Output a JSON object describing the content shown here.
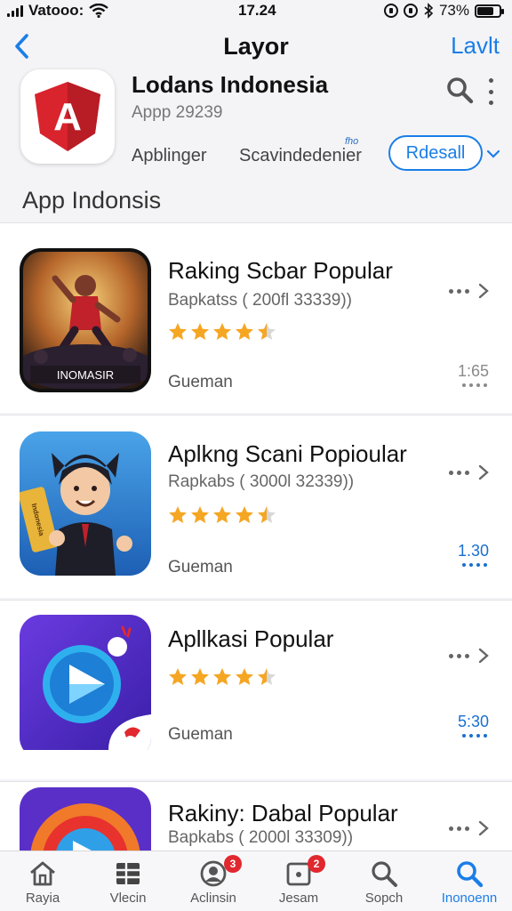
{
  "status_bar": {
    "carrier": "Vatooo:",
    "time": "17.24",
    "battery": "73%",
    "battery_level": 0.73
  },
  "nav": {
    "title": "Layor",
    "action": "Lavlt"
  },
  "app": {
    "icon_letter": "A",
    "title": "Lodans Indonesia",
    "subtitle": "Appp 29239",
    "tab1": "Apblinger",
    "tab2": "Scavindedenier",
    "tab2_sup": "fho",
    "button": "Rdesall"
  },
  "section_title": "App Indonsis",
  "apps": [
    {
      "title": "Raking Scbar Popular",
      "subtitle": "Bapkatss ( 200fl 33339))",
      "rating": 4.5,
      "category": "Gueman",
      "value": "1:65",
      "value_color": "#8a8a8a",
      "icon_label": "INOMASIR"
    },
    {
      "title": "Aplkng Scani Popioular",
      "subtitle": "Rapkabs ( 3000l 32339))",
      "rating": 4.5,
      "category": "Gueman",
      "value": "1.30",
      "value_color": "#1a6fd0",
      "icon_label": "Indonesia"
    },
    {
      "title": "Apllkasi Popular",
      "subtitle": "",
      "rating": 4.5,
      "category": "Gueman",
      "value": "5:30",
      "value_color": "#1a6fd0",
      "icon_label": ""
    },
    {
      "title": "Rakiny: Dabal Popular",
      "subtitle": "Bapkabs ( 2000l 33309))",
      "rating": 4.5,
      "category": "",
      "value": "",
      "value_color": "#1a6fd0",
      "icon_label": ""
    }
  ],
  "tabs": [
    {
      "label": "Rayia",
      "icon": "home-icon",
      "badge": ""
    },
    {
      "label": "Vlecin",
      "icon": "grid-icon",
      "badge": ""
    },
    {
      "label": "Aclinsin",
      "icon": "profile-icon",
      "badge": "3"
    },
    {
      "label": "Jesam",
      "icon": "box-icon",
      "badge": "2"
    },
    {
      "label": "Sopch",
      "icon": "search-icon",
      "badge": ""
    },
    {
      "label": "Inonoenn",
      "icon": "search-icon",
      "badge": "",
      "active": true
    }
  ],
  "colors": {
    "accent": "#1a7ee8",
    "star": "#f5a623",
    "badge": "#e0282e",
    "app_icon_red": "#d9232d"
  }
}
